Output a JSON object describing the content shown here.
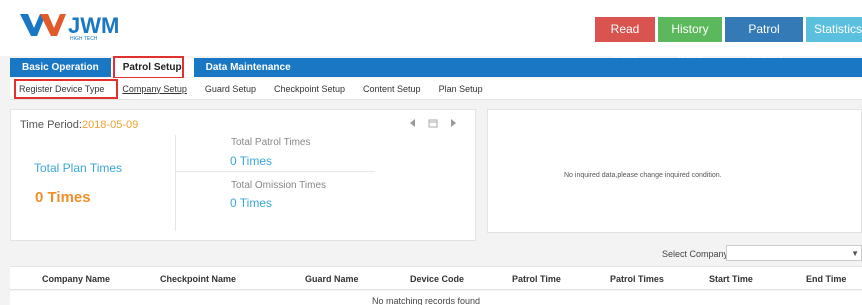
{
  "brand": {
    "name": "JWM",
    "tagline": "HIGH TECH"
  },
  "top_buttons": {
    "read": "Read Data",
    "history": "History Data",
    "report": "Patrol Report",
    "stats": "Statistics"
  },
  "tabs": [
    {
      "label": "Basic Operation"
    },
    {
      "label": "Patrol Setup"
    },
    {
      "label": "Data Maintenance"
    }
  ],
  "subtabs": [
    {
      "label": "Register Device Type"
    },
    {
      "label": "Company Setup"
    },
    {
      "label": "Guard Setup"
    },
    {
      "label": "Checkpoint Setup"
    },
    {
      "label": "Content Setup"
    },
    {
      "label": "Plan Setup"
    }
  ],
  "summary": {
    "time_period_label": "Time Period:",
    "time_period_value": "2018-05-09",
    "plan_title": "Total Plan Times",
    "plan_value": "0 Times",
    "patrol_title": "Total Patrol Times",
    "patrol_value": "0 Times",
    "omission_title": "Total Omission Times",
    "omission_value": "0 Times"
  },
  "right_panel": {
    "message": "No inquired data,please change inquired condition."
  },
  "filter": {
    "label": "Select Company",
    "value": ""
  },
  "table": {
    "columns": [
      "Company Name",
      "Checkpoint Name",
      "Guard Name",
      "Device Code",
      "Patrol Time",
      "Patrol Times",
      "Start Time",
      "End Time"
    ],
    "empty_message": "No matching records found"
  },
  "colors": {
    "accent": "#1977c3",
    "orange": "#f0902c",
    "blue_text": "#3ba7d8",
    "highlight": "#e03030"
  }
}
